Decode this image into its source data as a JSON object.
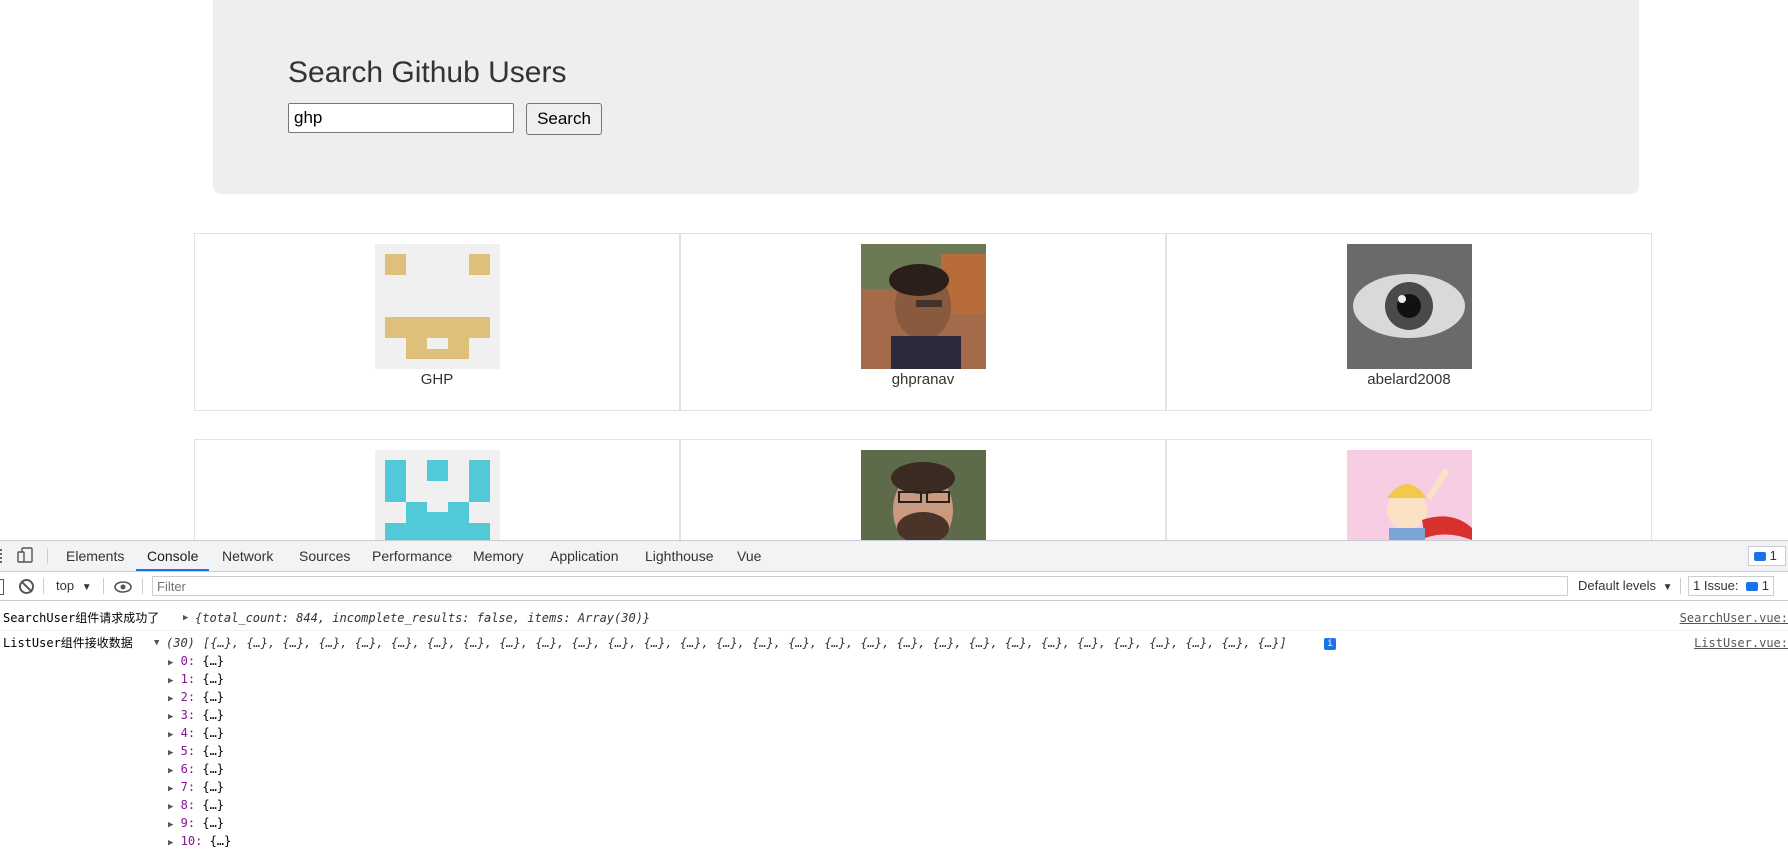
{
  "app": {
    "title": "Search Github Users",
    "search": {
      "value": "ghp",
      "button_label": "Search"
    }
  },
  "users": [
    {
      "login": "GHP",
      "avatar": "identicon-yellow-icon",
      "color": "#dec07b"
    },
    {
      "login": "ghpranav",
      "avatar": "photo-person-glasses-icon"
    },
    {
      "login": "abelard2008",
      "avatar": "eye-drawing-icon"
    },
    {
      "login": "",
      "avatar": "identicon-cyan-icon",
      "color": "#52c9d9"
    },
    {
      "login": "",
      "avatar": "photo-bearded-man-icon"
    },
    {
      "login": "",
      "avatar": "cartoon-little-prince-icon"
    }
  ],
  "devtools": {
    "tabs": [
      "Elements",
      "Console",
      "Network",
      "Sources",
      "Performance",
      "Memory",
      "Application",
      "Lighthouse",
      "Vue"
    ],
    "active_tab": "Console",
    "issues_badge": "1",
    "context": "top",
    "filter_placeholder": "Filter",
    "levels": "Default levels",
    "issues_label": "1 Issue:",
    "issues_count": "1",
    "messages": [
      {
        "prefix": "SearchUser组件请求成功了",
        "obj": "{total_count: 844, incomplete_results: false, items: Array(30)}",
        "source": "SearchUser.vue:"
      },
      {
        "prefix": "ListUser组件接收数据",
        "count": "(30)",
        "array": "[{…}, {…}, {…}, {…}, {…}, {…}, {…}, {…}, {…}, {…}, {…}, {…}, {…}, {…}, {…}, {…}, {…}, {…}, {…}, {…}, {…}, {…}, {…}, {…}, {…}, {…}, {…}, {…}, {…}, {…}]",
        "source": "ListUser.vue:"
      }
    ],
    "array_items": [
      {
        "key": "0:",
        "val": "{…}"
      },
      {
        "key": "1:",
        "val": "{…}"
      },
      {
        "key": "2:",
        "val": "{…}"
      },
      {
        "key": "3:",
        "val": "{…}"
      },
      {
        "key": "4:",
        "val": "{…}"
      },
      {
        "key": "5:",
        "val": "{…}"
      },
      {
        "key": "6:",
        "val": "{…}"
      },
      {
        "key": "7:",
        "val": "{…}"
      },
      {
        "key": "8:",
        "val": "{…}"
      },
      {
        "key": "9:",
        "val": "{…}"
      },
      {
        "key": "10:",
        "val": "{…}"
      }
    ],
    "accent_color": "#1a73e8"
  }
}
